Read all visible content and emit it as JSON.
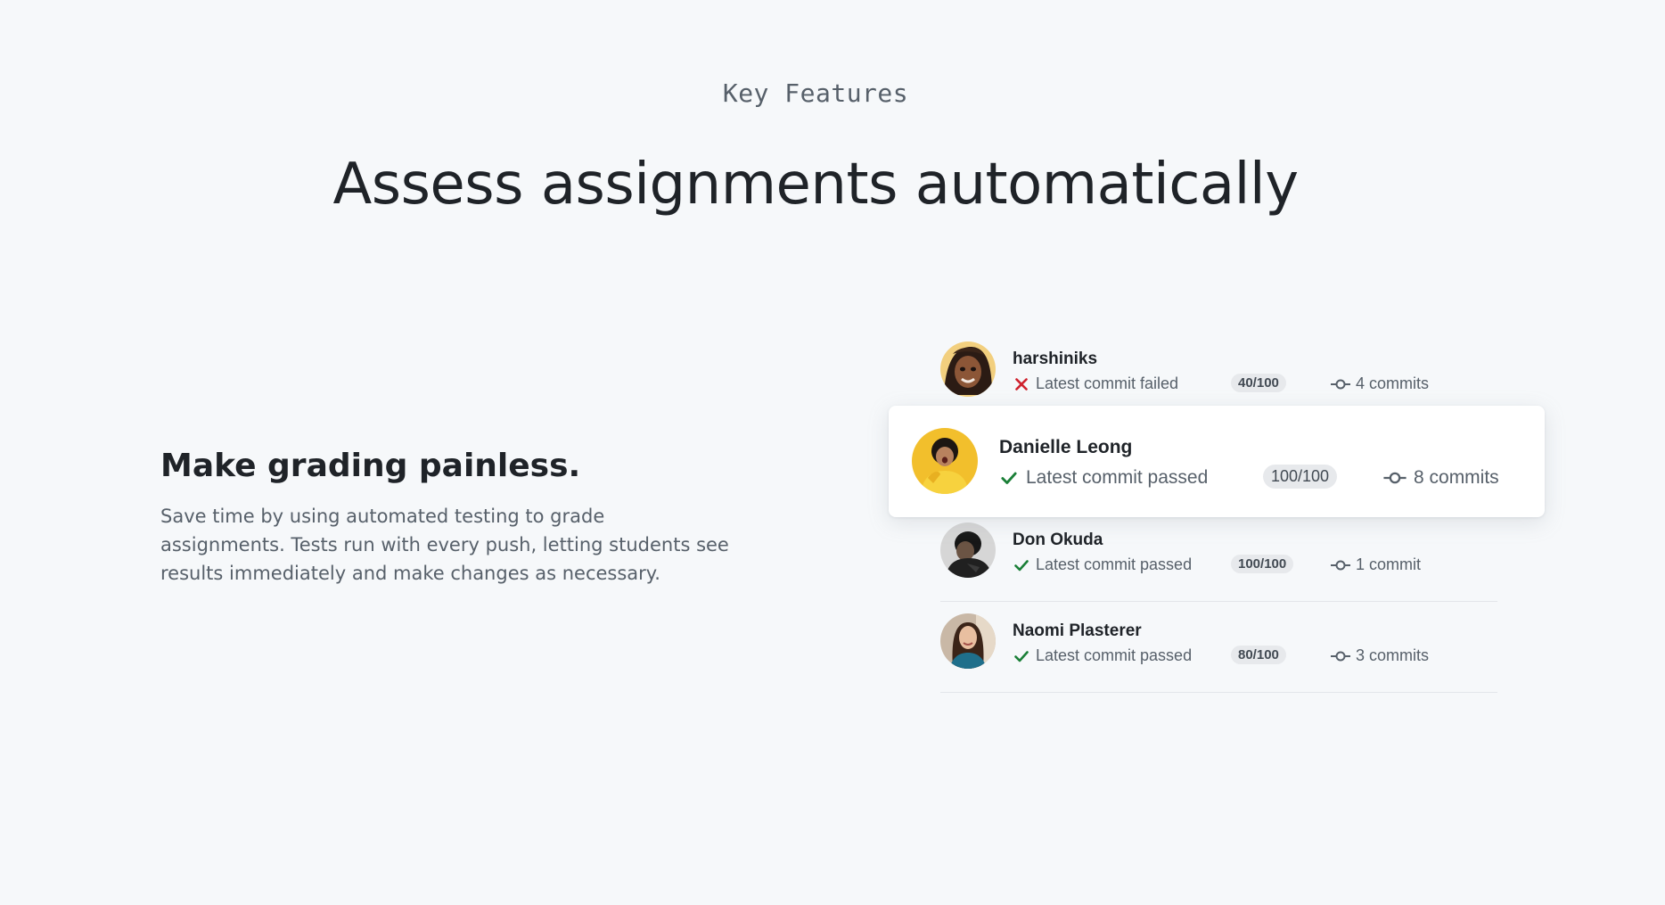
{
  "eyebrow": "Key Features",
  "headline": "Assess assignments automatically",
  "feature": {
    "title": "Make grading painless.",
    "description": "Save time by using automated testing to grade assignments. Tests run with every push, letting students see results immediately and make changes as necessary."
  },
  "students": [
    {
      "name": "harshiniks",
      "status": "Latest commit failed",
      "result": "failed",
      "score": "40/100",
      "commits": "4 commits"
    },
    {
      "name": "Danielle Leong",
      "status": "Latest commit passed",
      "result": "passed",
      "score": "100/100",
      "commits": "8 commits"
    },
    {
      "name": "Don Okuda",
      "status": "Latest commit passed",
      "result": "passed",
      "score": "100/100",
      "commits": "1 commit"
    },
    {
      "name": "Naomi Plasterer",
      "status": "Latest commit passed",
      "result": "passed",
      "score": "80/100",
      "commits": "3 commits"
    }
  ],
  "colors": {
    "passed": "#1a7f37",
    "failed": "#cf222e",
    "background": "#f6f8fa"
  },
  "icons": {
    "passed": "check-icon",
    "failed": "x-icon",
    "commits": "git-commit-icon"
  }
}
